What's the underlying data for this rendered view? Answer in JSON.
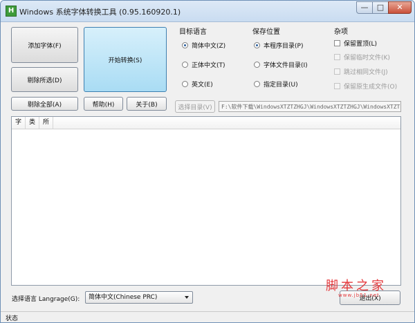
{
  "window": {
    "title": "Windows 系统字体转换工具 (0.95.160920.1)",
    "icon_letter": "H",
    "controls": {
      "minimize": "—",
      "maximize": "□",
      "close": "✕"
    }
  },
  "buttons": {
    "add_font": "添加字体(F)",
    "remove_selected": "剔除所选(D)",
    "remove_all": "剔除全部(A)",
    "start_convert": "开始转换(S)",
    "help": "帮助(H)",
    "about": "关于(B)",
    "choose_dir": "选择目录(V)",
    "exit": "退出(X)"
  },
  "target_language": {
    "title": "目标语言",
    "options": [
      {
        "label": "简体中文(Z)",
        "checked": true
      },
      {
        "label": "正体中文(T)",
        "checked": false
      },
      {
        "label": "英文(E)",
        "checked": false
      }
    ]
  },
  "save_location": {
    "title": "保存位置",
    "options": [
      {
        "label": "本程序目录(P)",
        "checked": true
      },
      {
        "label": "字体文件目录(I)",
        "checked": false
      },
      {
        "label": "指定目录(U)",
        "checked": false
      }
    ]
  },
  "misc": {
    "title": "杂项",
    "options": [
      {
        "label": "保留置顶(L)",
        "checked": false,
        "enabled": true
      },
      {
        "label": "保留临时文件(K)",
        "checked": false,
        "enabled": false
      },
      {
        "label": "跳过相同文件(J)",
        "checked": false,
        "enabled": false
      },
      {
        "label": "保留原生成文件(O)",
        "checked": false,
        "enabled": false
      }
    ]
  },
  "path": {
    "value": "F:\\软件下载\\WindowsXTZTZHGJ\\WindowsXTZTZHGJ\\WindowsXTZTZ"
  },
  "list": {
    "columns": [
      "字",
      "类",
      "所"
    ]
  },
  "language_select": {
    "label": "选择语言 Langrage(G):",
    "value": "简体中文(Chinese PRC)"
  },
  "status": {
    "text": "状态"
  },
  "watermark": {
    "text": "脚本之家",
    "url": "www.jb51.net"
  }
}
